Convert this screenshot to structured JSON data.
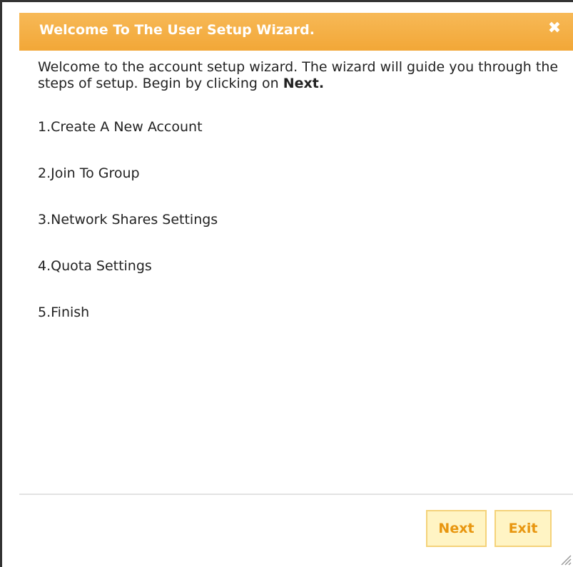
{
  "dialog": {
    "title": "Welcome To The User Setup Wizard.",
    "close_icon": "close-icon"
  },
  "intro": {
    "text": "Welcome to the account setup wizard. The wizard will guide you through the steps of setup. Begin by clicking on ",
    "bold": "Next."
  },
  "steps": [
    {
      "label": "1.Create A New Account"
    },
    {
      "label": "2.Join To Group"
    },
    {
      "label": "3.Network Shares Settings"
    },
    {
      "label": "4.Quota Settings"
    },
    {
      "label": "5.Finish"
    }
  ],
  "buttons": {
    "next_label": "Next",
    "exit_label": "Exit"
  },
  "colors": {
    "titlebar": "#f2a737",
    "title_text": "#ffffff",
    "button_bg": "#fff4c4",
    "button_border": "#f4d27a",
    "button_text": "#e8960f"
  }
}
